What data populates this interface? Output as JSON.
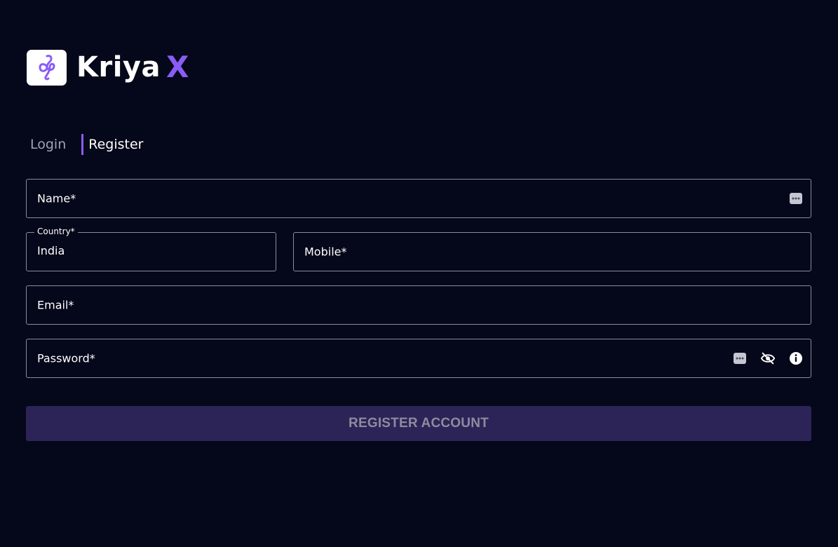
{
  "brand": {
    "word": "Kriya",
    "suffix": "X",
    "accent_color": "#8a5cf6",
    "badge_icon": "kx-logo-icon"
  },
  "tabs": [
    {
      "label": "Login",
      "active": false
    },
    {
      "label": "Register",
      "active": true
    }
  ],
  "form": {
    "name": {
      "label": "Name*",
      "icon": "more-dots-icon"
    },
    "country": {
      "label": "Country*",
      "value": "India"
    },
    "mobile": {
      "label": "Mobile*"
    },
    "email": {
      "label": "Email*"
    },
    "password": {
      "label": "Password*",
      "icons": [
        "more-dots-icon",
        "eye-off-icon",
        "info-icon"
      ]
    },
    "submit_label": "REGISTER ACCOUNT"
  },
  "colors": {
    "background": "#05071a",
    "button_bg": "#2c2457",
    "button_text": "#8e8b9e",
    "border": "#8a8d9b"
  }
}
